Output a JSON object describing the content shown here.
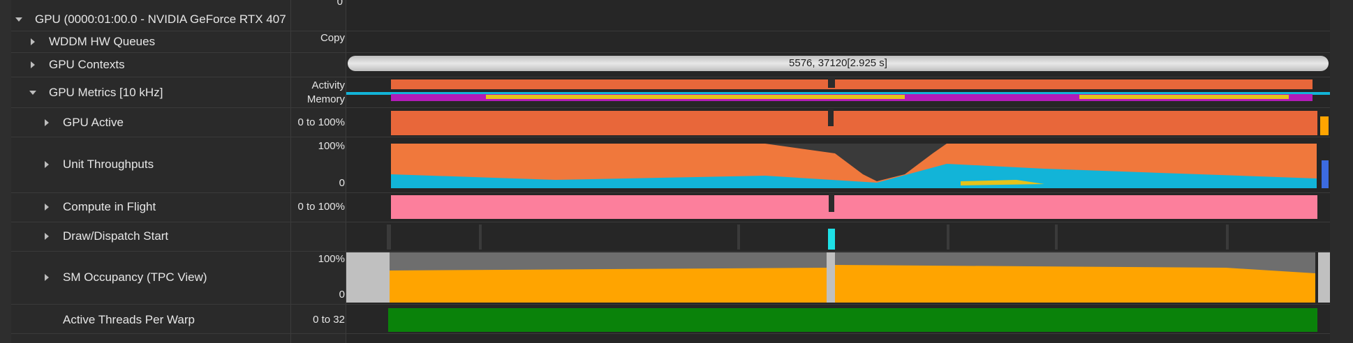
{
  "tree": {
    "gpu_label": "GPU (0000:01:00.0 - NVIDIA GeForce RTX 407",
    "rows": [
      {
        "label": "WDDM HW Queues",
        "range": "Copy"
      },
      {
        "label": "GPU Contexts",
        "range": ""
      },
      {
        "label": "GPU Metrics [10 kHz]",
        "range": ""
      },
      {
        "label": "GPU Active",
        "range": "0 to 100%"
      },
      {
        "label": "Unit Throughputs",
        "range": ""
      },
      {
        "label": "Compute in Flight",
        "range": "0 to 100%"
      },
      {
        "label": "Draw/Dispatch Start",
        "range": ""
      },
      {
        "label": "SM Occupancy (TPC View)",
        "range": ""
      },
      {
        "label": "Active Threads Per Warp",
        "range": "0 to 32"
      }
    ]
  },
  "metric_labels": {
    "activity": "Activity",
    "memory": "Memory",
    "top_zero": "0",
    "unit_top": "100%",
    "unit_bottom": "0",
    "sm_top": "100%",
    "sm_bottom": "0"
  },
  "gpu_context_bar": {
    "text": "5576, 37120[2.925 s]"
  },
  "colors": {
    "orange_red": "#e8673a",
    "orange": "#f0783c",
    "cyan": "#12b4d8",
    "yellow": "#e6c21a",
    "magenta": "#b21cb8",
    "pink": "#fc7f9c",
    "sm_orange": "#ffa400",
    "sm_gray": "#6e6e6e",
    "green": "#0a820a",
    "draw_cyan": "#1ee0e6"
  },
  "icons": {
    "expand": "triangle-right-icon",
    "collapse": "triangle-down-icon"
  }
}
